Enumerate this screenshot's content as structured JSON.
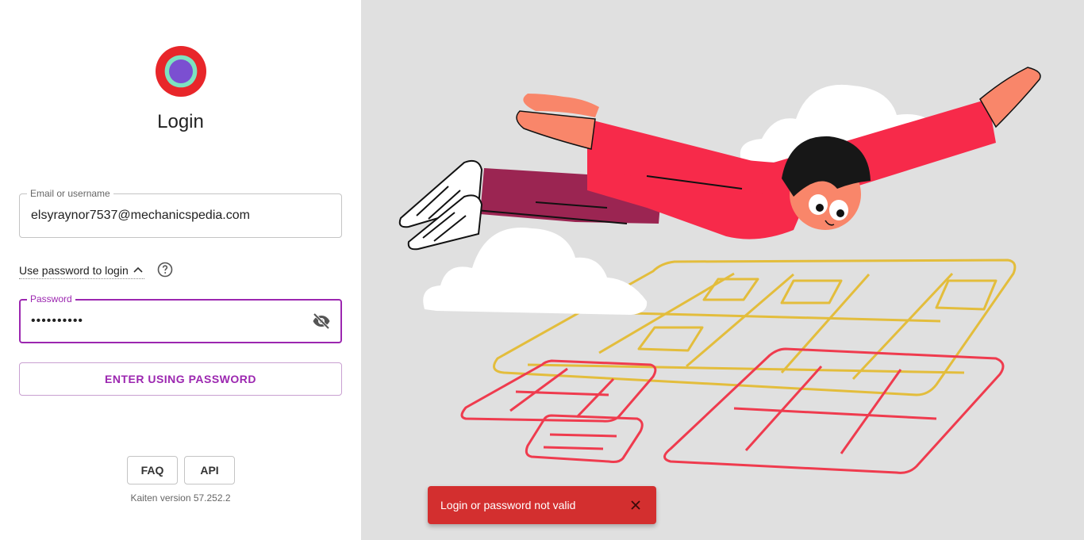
{
  "login": {
    "title": "Login",
    "email": {
      "label": "Email or username",
      "value": "elsyraynor7537@mechanicspedia.com"
    },
    "password_toggle_label": "Use password to login",
    "password": {
      "label": "Password",
      "value": "••••••••••"
    },
    "enter_button": "ENTER USING PASSWORD",
    "faq_button": "FAQ",
    "api_button": "API",
    "version": "Kaiten version 57.252.2"
  },
  "toast": {
    "message": "Login or password not valid"
  },
  "colors": {
    "accent": "#9c27b0",
    "error": "#d32f2f",
    "panel_bg": "#e0e0e0"
  }
}
